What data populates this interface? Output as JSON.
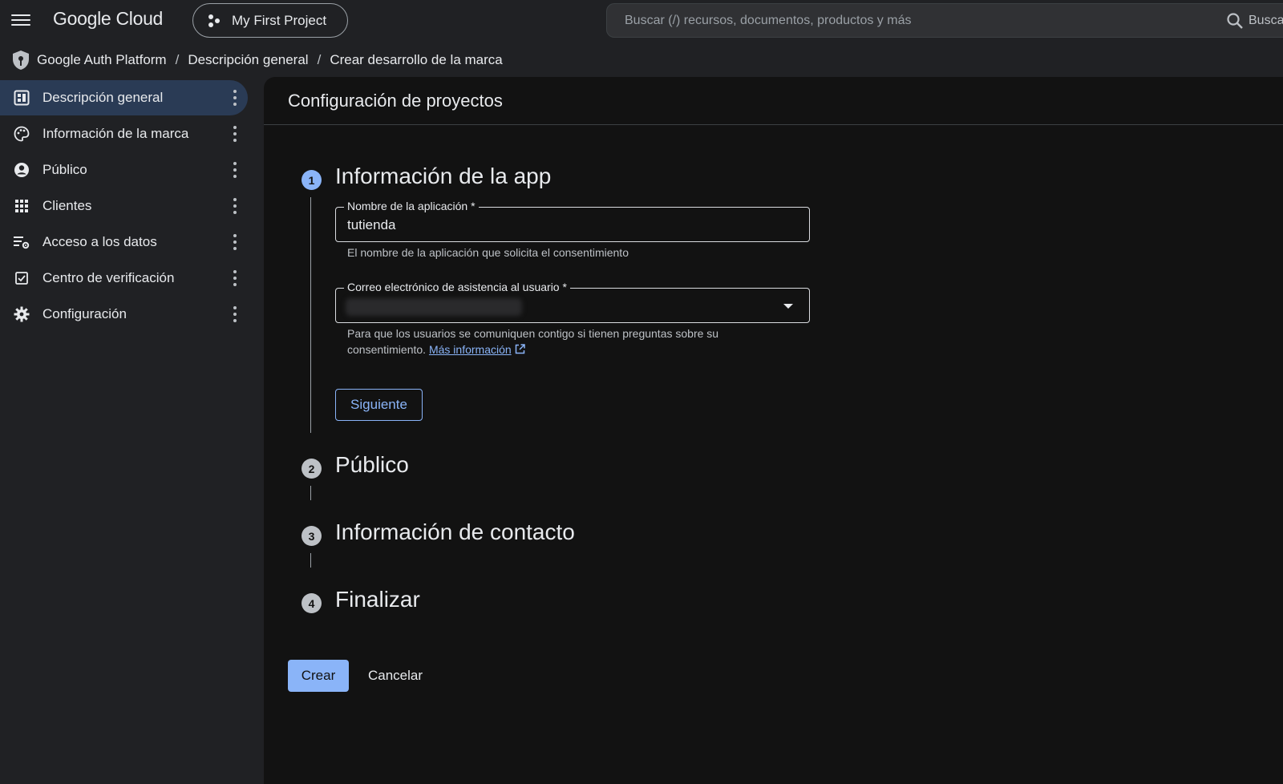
{
  "topbar": {
    "logo": "Google Cloud",
    "project": "My First Project",
    "search_placeholder": "Buscar (/) recursos, documentos, productos y más",
    "search_button": "Busca"
  },
  "breadcrumb": [
    "Google Auth Platform",
    "Descripción general",
    "Crear desarrollo de la marca"
  ],
  "sidebar": {
    "items": [
      {
        "label": "Descripción general",
        "icon": "dashboard-icon"
      },
      {
        "label": "Información de la marca",
        "icon": "palette-icon"
      },
      {
        "label": "Público",
        "icon": "account-circle-icon"
      },
      {
        "label": "Clientes",
        "icon": "apps-grid-icon"
      },
      {
        "label": "Acceso a los datos",
        "icon": "data-access-icon"
      },
      {
        "label": "Centro de verificación",
        "icon": "checkbox-icon"
      },
      {
        "label": "Configuración",
        "icon": "gear-icon"
      }
    ]
  },
  "main": {
    "title": "Configuración de proyectos",
    "steps": [
      {
        "num": "1",
        "title": "Información de la app"
      },
      {
        "num": "2",
        "title": "Público"
      },
      {
        "num": "3",
        "title": "Información de contacto"
      },
      {
        "num": "4",
        "title": "Finalizar"
      }
    ],
    "app_name": {
      "label": "Nombre de la aplicación *",
      "value": "tutienda",
      "hint": "El nombre de la aplicación que solicita el consentimiento"
    },
    "support_email": {
      "label": "Correo electrónico de asistencia al usuario *",
      "hint": "Para que los usuarios se comuniquen contigo si tienen preguntas sobre su consentimiento.",
      "link": "Más información"
    },
    "next_button": "Siguiente",
    "create_button": "Crear",
    "cancel_button": "Cancelar"
  },
  "colors": {
    "accent": "#8ab4f8",
    "active_nav": "#2a3b55",
    "background": "#121212"
  }
}
